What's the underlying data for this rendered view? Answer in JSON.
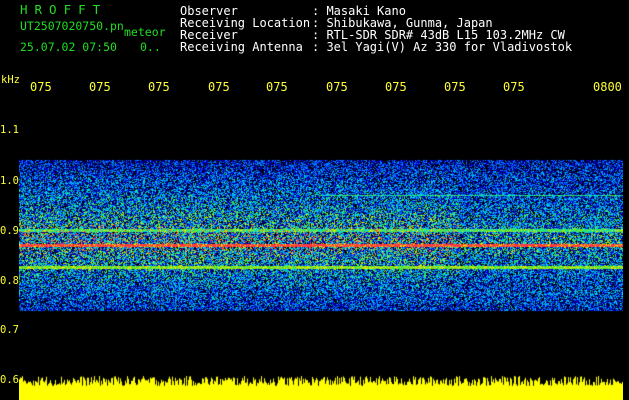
{
  "header": {
    "logo": "HROFFT",
    "filename": "UT2507020750.pn",
    "tag": "meteor",
    "datetime": "25.07.02 07:50",
    "count": "0..",
    "labels": [
      "Observer",
      "Receiving Location",
      "Receiver",
      "Receiving Antenna"
    ],
    "values": [
      ": Masaki Kano",
      ": Shibukawa, Gunma, Japan",
      ": RTL-SDR SDR# 43dB L15 103.2MHz CW",
      ": 3el Yagi(V) Az 330 for Vladivostok"
    ]
  },
  "axis": {
    "unit": "kHz",
    "y_labels": [
      "1.1",
      "1.0",
      "0.9",
      "0.8",
      "0.7",
      "0.6"
    ],
    "x_labels": [
      "075",
      "075",
      "075",
      "075",
      "075",
      "075",
      "075",
      "075",
      "075",
      "0800"
    ]
  },
  "colors": {
    "text_green": "#22dd22",
    "label_yellow": "#ffff33",
    "background": "#000000"
  }
}
